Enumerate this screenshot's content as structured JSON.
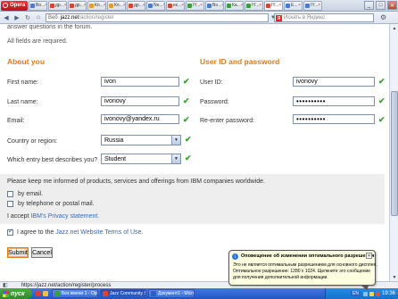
{
  "browser": {
    "opera_label": "Opera",
    "tabs": [
      {
        "label": "Во...",
        "color": "#4a7bd1"
      },
      {
        "label": "др...",
        "color": "#d9452f"
      },
      {
        "label": "др...",
        "color": "#d9452f"
      },
      {
        "label": "Ко...",
        "color": "#e79c2c"
      },
      {
        "label": "Ко...",
        "color": "#e79c2c"
      },
      {
        "label": "др...",
        "color": "#d9452f"
      },
      {
        "label": "Ne...",
        "color": "#4a7bd1"
      },
      {
        "label": "ек...",
        "color": "#d9452f"
      },
      {
        "label": "IY...",
        "color": "#3aa035"
      },
      {
        "label": "Во...",
        "color": "#4a7bd1"
      },
      {
        "label": "Ка...",
        "color": "#3aa035"
      },
      {
        "label": "IY...",
        "color": "#3aa035"
      },
      {
        "label": "IY...",
        "color": "#d9452f"
      },
      {
        "label": "Е...",
        "color": "#4a7bd1"
      },
      {
        "label": "IY...",
        "color": "#4a7bd1"
      }
    ],
    "address_prefix": "Веб",
    "address_host": "jazz.net",
    "address_path": "/action/register",
    "search_placeholder": "Искать в Яндекс",
    "search_engine_letter": "Я"
  },
  "page": {
    "intro_text": "answer questions in the forum.",
    "required_note": "All fields are required.",
    "about_heading": "About you",
    "userid_heading": "User ID and password",
    "first_name_label": "First name:",
    "first_name_value": "ivon",
    "last_name_label": "Last name:",
    "last_name_value": "ivonovy",
    "email_label": "Email:",
    "email_value": "ivonovy@yandex.ru",
    "country_label": "Country or region:",
    "country_value": "Russia",
    "entry_label": "Which entry best describes you?",
    "entry_value": "Student",
    "userid_label": "User ID:",
    "userid_value": "ivonovy",
    "password_label": "Password:",
    "password_value": "••••••••••",
    "reenter_label": "Re-enter password:",
    "reenter_value": "••••••••••",
    "keep_informed": "Please keep me informed of products, services and offerings from IBM companies worldwide.",
    "by_email": "by email.",
    "by_phone": "by telephone or postal mail.",
    "accept_prefix": "I accept",
    "privacy_link": "IBM's Privacy statement.",
    "agree_prefix": "I agree to the",
    "terms_link": "Jazz.net Website Terms of Use.",
    "submit_label": "Submit",
    "cancel_label": "Cancel"
  },
  "status": {
    "url": "https://jazz.net/action/register/process"
  },
  "taskbar": {
    "start_label": "пуск",
    "tasks": [
      {
        "label": "Без имени 1 - OpenO...",
        "color": "#3aa035"
      },
      {
        "label": "Jazz Community Site ...",
        "color": "#d9452f"
      },
      {
        "label": "Документ1 - Microso...",
        "color": "#2c5ec8"
      }
    ],
    "lang": "EN",
    "clock": "19:36"
  },
  "balloon": {
    "title": "Оповещение об изменении оптимального разрешения",
    "line1": "Это не является оптимальным разрешением для основного дисплея.",
    "line2": "Оптимальное разрешение: 1280 x 1024. Щелкните это сообщение",
    "line3": "для получения дополнительной информации."
  }
}
